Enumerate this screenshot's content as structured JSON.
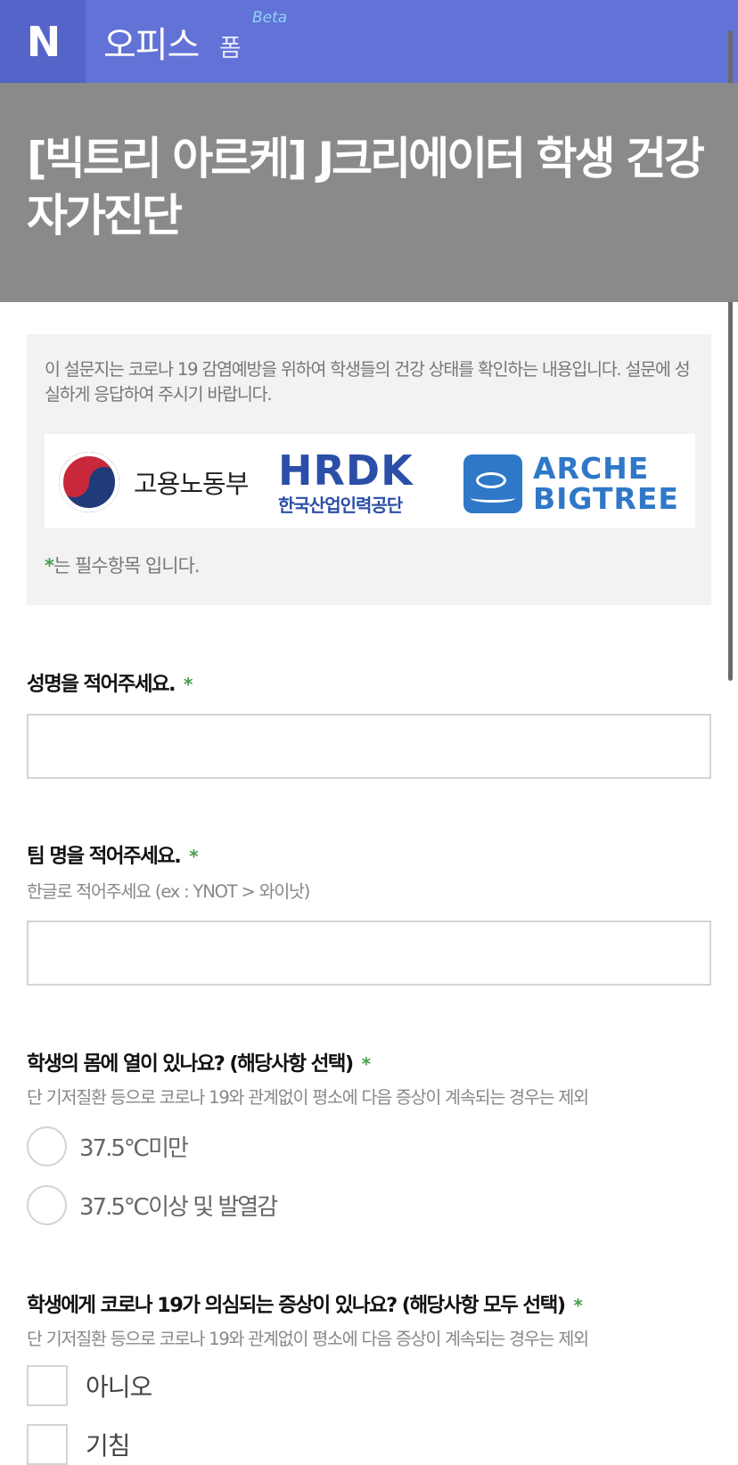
{
  "app": {
    "logo_letter": "N",
    "brand": "오피스",
    "brand_sub": "폼",
    "beta": "Beta"
  },
  "form": {
    "title": "[빅트리 아르케] J크리에이터 학생 건강 자가진단",
    "intro": "이 설문지는 코로나 19 감염예방을 위하여 학생들의 건강 상태를 확인하는 내용입니다. 설문에 성실하게 응답하여 주시기 바랍니다.",
    "logos": {
      "moel": "고용노동부",
      "hrdk_mark": "HRDK",
      "hrdk_sub": "한국산업인력공단",
      "arche_line1": "ARCHE",
      "arche_line2": "BIGTREE"
    },
    "required_star": "*",
    "required_note": "는 필수항목 입니다."
  },
  "questions": [
    {
      "label": "성명을 적어주세요.",
      "star": "*"
    },
    {
      "label": "팀 명을 적어주세요.",
      "star": "*",
      "help": "한글로 적어주세요 (ex : YNOT > 와이낫)"
    },
    {
      "label": "학생의 몸에 열이 있나요? (해당사항 선택)",
      "star": "*",
      "help": "단 기저질환 등으로 코로나 19와 관계없이 평소에 다음 증상이 계속되는 경우는 제외",
      "options": [
        "37.5℃미만",
        "37.5℃이상 및 발열감"
      ]
    },
    {
      "label": "학생에게 코로나 19가 의심되는 증상이 있나요? (해당사항 모두 선택)",
      "star": "*",
      "help": "단 기저질환 등으로 코로나 19와 관계없이 평소에 다음 증상이 계속되는 경우는 제외",
      "options": [
        "아니오",
        "기침"
      ]
    }
  ]
}
